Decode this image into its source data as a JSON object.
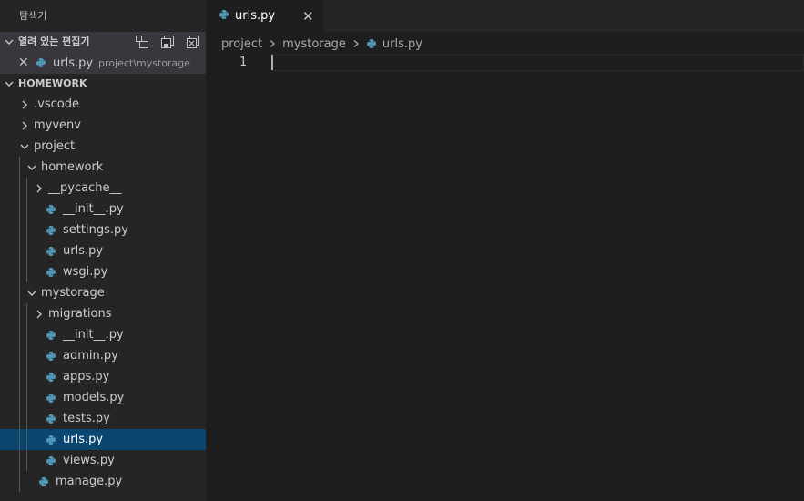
{
  "sidebar": {
    "title": "탐색기",
    "open_editors": {
      "header": "열려 있는 편집기",
      "items": [
        {
          "name": "urls.py",
          "path": "project\\mystorage"
        }
      ],
      "actions": [
        "new-untitled-icon",
        "save-all-icon",
        "close-all-icon"
      ]
    },
    "workspace": {
      "header": "HOMEWORK",
      "items": [
        {
          "label": ".vscode",
          "type": "folder",
          "expanded": false
        },
        {
          "label": "myvenv",
          "type": "folder",
          "expanded": false
        },
        {
          "label": "project",
          "type": "folder",
          "expanded": true
        },
        {
          "label": "homework",
          "type": "folder",
          "expanded": true
        },
        {
          "label": "__pycache__",
          "type": "folder",
          "expanded": false
        },
        {
          "label": "__init__.py",
          "type": "python"
        },
        {
          "label": "settings.py",
          "type": "python"
        },
        {
          "label": "urls.py",
          "type": "python"
        },
        {
          "label": "wsgi.py",
          "type": "python"
        },
        {
          "label": "mystorage",
          "type": "folder",
          "expanded": true
        },
        {
          "label": "migrations",
          "type": "folder",
          "expanded": false
        },
        {
          "label": "__init__.py",
          "type": "python"
        },
        {
          "label": "admin.py",
          "type": "python"
        },
        {
          "label": "apps.py",
          "type": "python"
        },
        {
          "label": "models.py",
          "type": "python"
        },
        {
          "label": "tests.py",
          "type": "python"
        },
        {
          "label": "urls.py",
          "type": "python",
          "selected": true
        },
        {
          "label": "views.py",
          "type": "python"
        },
        {
          "label": "manage.py",
          "type": "python"
        }
      ]
    }
  },
  "tabs": [
    {
      "label": "urls.py",
      "active": true
    }
  ],
  "breadcrumb": {
    "parts": [
      "project",
      "mystorage",
      "urls.py"
    ]
  },
  "editor": {
    "line_numbers": [
      "1"
    ]
  },
  "colors": {
    "sidebar_bg": "#252526",
    "editor_bg": "#1e1e1e",
    "selection": "#094771",
    "python_icon": "#519aba"
  }
}
